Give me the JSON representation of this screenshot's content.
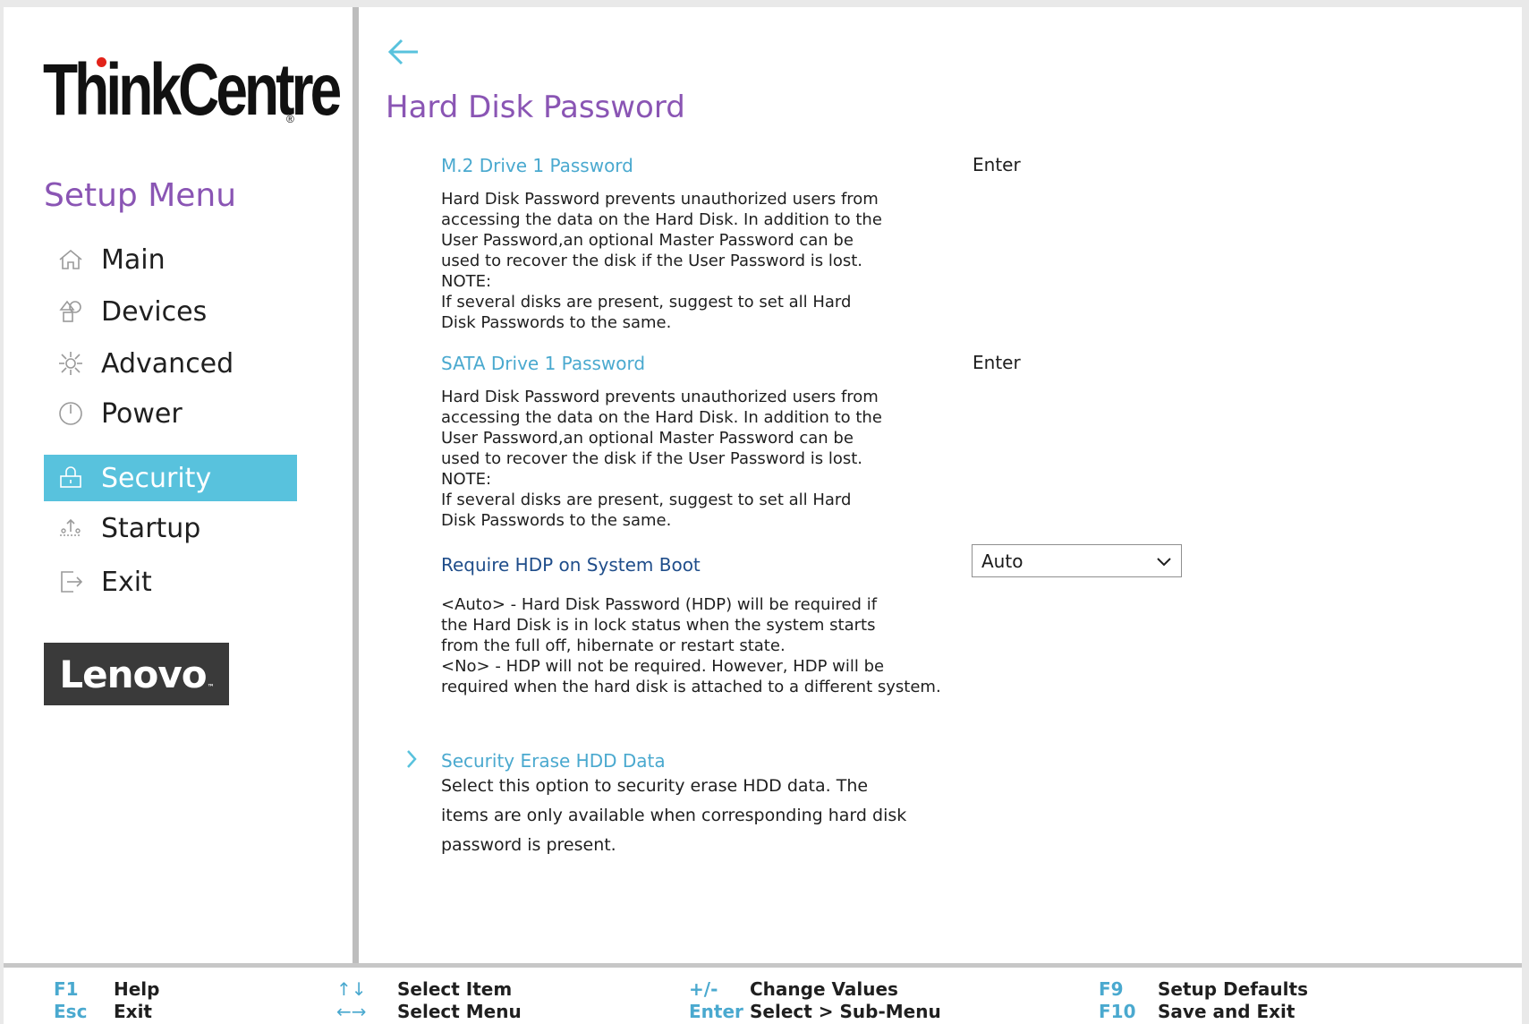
{
  "brand": {
    "name": "ThinkCentre",
    "reg": "®"
  },
  "sidebar": {
    "title": "Setup Menu",
    "items": [
      {
        "label": "Main",
        "icon": "home-icon"
      },
      {
        "label": "Devices",
        "icon": "devices-icon"
      },
      {
        "label": "Advanced",
        "icon": "advanced-icon"
      },
      {
        "label": "Power",
        "icon": "power-icon"
      },
      {
        "label": "Security",
        "icon": "lock-icon",
        "active": true
      },
      {
        "label": "Startup",
        "icon": "startup-icon"
      },
      {
        "label": "Exit",
        "icon": "exit-icon"
      }
    ],
    "vendor_logo": "Lenovo",
    "vendor_tm": "™"
  },
  "main": {
    "title": "Hard Disk Password",
    "settings": [
      {
        "name": "M.2 Drive 1 Password",
        "value": "Enter",
        "description": "Hard Disk Password prevents unauthorized users from\naccessing the data on the Hard Disk. In addition to the\nUser Password,an optional Master Password can be\nused to recover the disk if the User Password is lost.\nNOTE:\nIf several disks are present, suggest to set all Hard\nDisk Passwords to the same."
      },
      {
        "name": "SATA Drive 1 Password",
        "value": "Enter",
        "description": "Hard Disk Password prevents unauthorized users from\naccessing the data on the Hard Disk. In addition to the\nUser Password,an optional Master Password can be\nused to recover the disk if the User Password is lost.\nNOTE:\nIf several disks are present, suggest to set all Hard\nDisk Passwords to the same."
      },
      {
        "name": "Require HDP on System Boot",
        "value": "Auto",
        "description": "<Auto> - Hard Disk Password (HDP) will be required if\nthe Hard Disk is in lock status when the system starts\nfrom the full off, hibernate or restart state.\n<No> - HDP will not be required. However, HDP will be\nrequired when the hard disk is attached to a different system."
      },
      {
        "name": "Security Erase HDD Data",
        "description": "Select this option to security erase HDD data. The\nitems are only available when corresponding hard disk\npassword is present."
      }
    ]
  },
  "footer": {
    "keys": [
      {
        "key": "F1",
        "label": "Help"
      },
      {
        "key": "Esc",
        "label": "Exit"
      },
      {
        "key": "↑↓",
        "label": "Select Item"
      },
      {
        "key": "←→",
        "label": "Select Menu"
      },
      {
        "key": "+/-",
        "label": "Change Values"
      },
      {
        "key": "Enter",
        "label": "Select > Sub-Menu"
      },
      {
        "key": "F9",
        "label": "Setup Defaults"
      },
      {
        "key": "F10",
        "label": "Save and Exit"
      }
    ]
  },
  "colors": {
    "accent_purple": "#8a55b4",
    "accent_cyan": "#58c2dd",
    "link_blue": "#4aa9cf",
    "dark_blue": "#1f4d8a",
    "brand_red": "#e2231a"
  }
}
